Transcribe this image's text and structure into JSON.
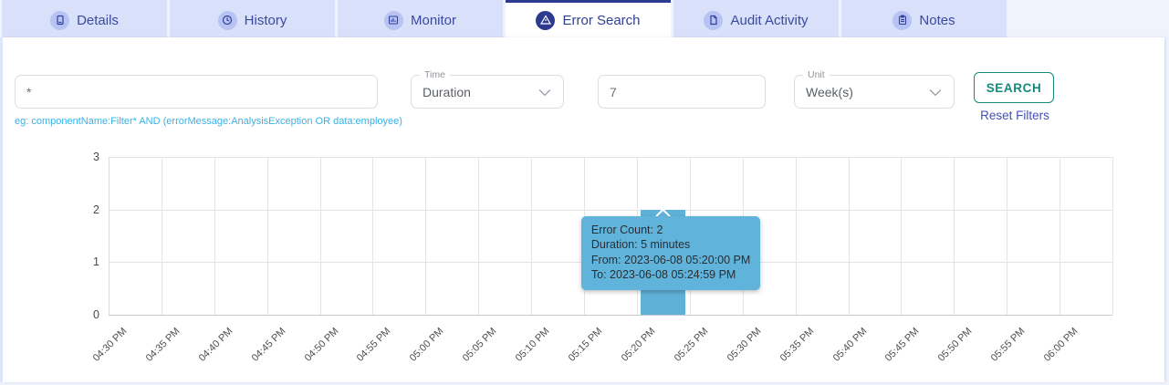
{
  "tabs": {
    "items": [
      {
        "label": "Details",
        "icon": "document-icon",
        "active": false
      },
      {
        "label": "History",
        "icon": "history-icon",
        "active": false
      },
      {
        "label": "Monitor",
        "icon": "monitor-icon",
        "active": false
      },
      {
        "label": "Error Search",
        "icon": "error-triangle-icon",
        "active": true
      },
      {
        "label": "Audit Activity",
        "icon": "audit-file-icon",
        "active": false
      },
      {
        "label": "Notes",
        "icon": "notes-icon",
        "active": false
      }
    ]
  },
  "filters": {
    "query": {
      "value": "*",
      "hint": "eg: componentName:Filter* AND (errorMessage:AnalysisException OR data:employee)"
    },
    "time": {
      "label": "Time",
      "value": "Duration"
    },
    "duration": {
      "value": "7"
    },
    "unit": {
      "label": "Unit",
      "value": "Week(s)"
    },
    "search_label": "SEARCH",
    "reset_label": "Reset Filters"
  },
  "chart_data": {
    "type": "bar",
    "categories": [
      "04:30 PM",
      "04:35 PM",
      "04:40 PM",
      "04:45 PM",
      "04:50 PM",
      "04:55 PM",
      "05:00 PM",
      "05:05 PM",
      "05:10 PM",
      "05:15 PM",
      "05:20 PM",
      "05:25 PM",
      "05:30 PM",
      "05:35 PM",
      "05:40 PM",
      "05:45 PM",
      "05:50 PM",
      "05:55 PM",
      "06:00 PM"
    ],
    "values": [
      0,
      0,
      0,
      0,
      0,
      0,
      0,
      0,
      0,
      0,
      2,
      0,
      0,
      0,
      0,
      0,
      0,
      0,
      0
    ],
    "title": "",
    "xlabel": "",
    "ylabel": "",
    "ylim": [
      0,
      3
    ],
    "yticks": [
      0,
      1,
      2,
      3
    ],
    "grid": true,
    "legend": false,
    "bar_color": "#5fb1d8",
    "tooltip": {
      "anchor_category": "05:20 PM",
      "lines": [
        "Error Count: 2",
        "Duration: 5 minutes",
        "From: 2023-06-08 05:20:00 PM",
        "To: 2023-06-08 05:24:59 PM"
      ]
    }
  },
  "colors": {
    "accent_indigo": "#2c3a8f",
    "tab_inactive_bg": "#d8e0fa",
    "hint_blue": "#38b2e8",
    "search_teal": "#14897c",
    "reset_indigo": "#4350b5",
    "bar_blue": "#5fb1d8",
    "tooltip_bg": "#60b3da"
  }
}
